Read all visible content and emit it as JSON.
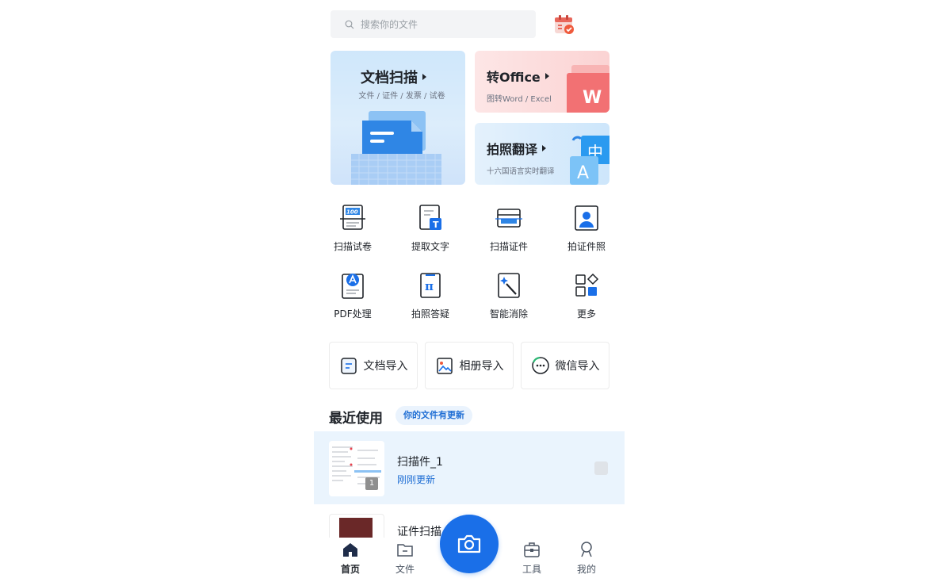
{
  "search": {
    "placeholder": "搜索你的文件"
  },
  "cards": {
    "scan": {
      "title": "文档扫描",
      "subtitle": "文件 / 证件 / 发票 / 试卷"
    },
    "office": {
      "title": "转Office",
      "subtitle": "图转Word / Excel",
      "badge_letter": "W"
    },
    "translate": {
      "title": "拍照翻译",
      "subtitle": "十六国语言实时翻译",
      "glyph_cn": "中",
      "glyph_en": "A"
    }
  },
  "tools": [
    {
      "label": "扫描试卷",
      "icon": "exam-scan-icon",
      "icon_text": "100"
    },
    {
      "label": "提取文字",
      "icon": "extract-text-icon",
      "icon_text": "T"
    },
    {
      "label": "扫描证件",
      "icon": "id-card-scan-icon"
    },
    {
      "label": "拍证件照",
      "icon": "id-photo-icon"
    },
    {
      "label": "PDF处理",
      "icon": "pdf-icon"
    },
    {
      "label": "拍照答疑",
      "icon": "pi-question-icon",
      "icon_text": "π"
    },
    {
      "label": "智能消除",
      "icon": "magic-erase-icon"
    },
    {
      "label": "更多",
      "icon": "more-grid-icon"
    }
  ],
  "imports": [
    {
      "label": "文档导入",
      "icon": "document-import-icon"
    },
    {
      "label": "相册导入",
      "icon": "album-import-icon"
    },
    {
      "label": "微信导入",
      "icon": "wechat-import-icon"
    }
  ],
  "recent": {
    "title": "最近使用",
    "badge": "你的文件有更新",
    "files": [
      {
        "name": "扫描件_1",
        "time": "刚刚更新",
        "pages": "1"
      },
      {
        "name": "证件扫描"
      }
    ]
  },
  "nav": [
    {
      "label": "首页",
      "icon": "home-icon",
      "active": true
    },
    {
      "label": "文件",
      "icon": "folder-icon"
    },
    {
      "label": "工具",
      "icon": "toolbox-icon"
    },
    {
      "label": "我的",
      "icon": "profile-icon"
    }
  ],
  "colors": {
    "accent": "#1a6fe8",
    "link": "#1f6ed4",
    "office_red": "#e8434f"
  }
}
